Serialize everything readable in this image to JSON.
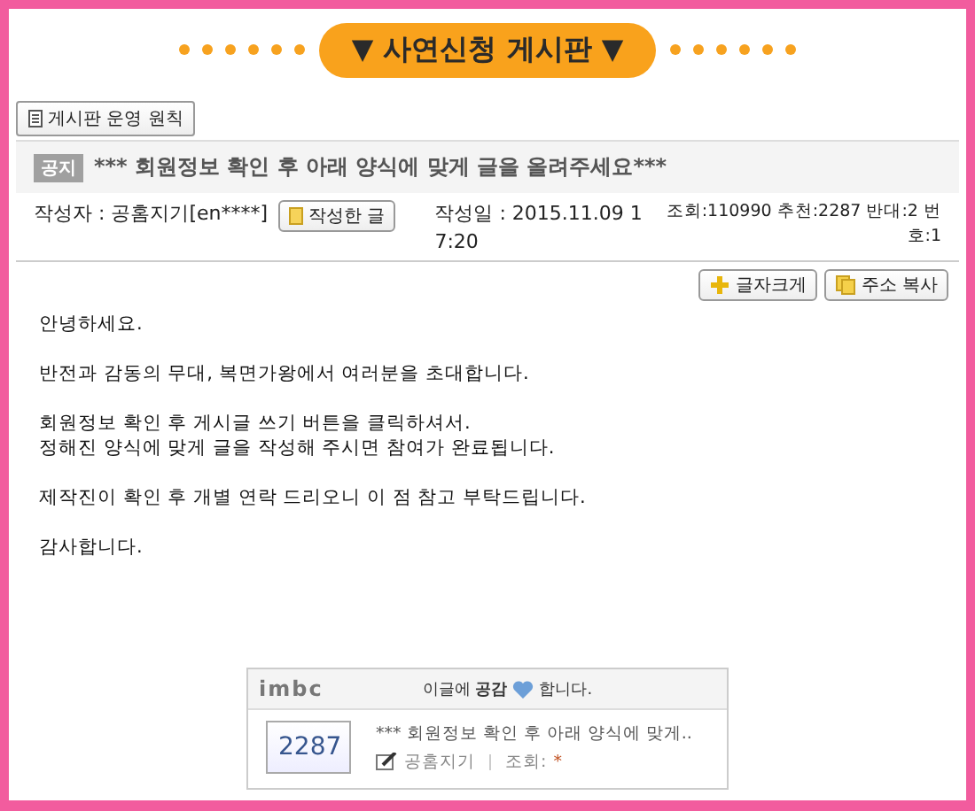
{
  "header": {
    "title": "▼ 사연신청 게시판 ▼"
  },
  "rules_button": "게시판 운영 원칙",
  "post": {
    "notice_badge": "공지",
    "title": "*** 회원정보 확인 후 아래 양식에 맞게 글을 올려주세요***",
    "author": "작성자 : 공홈지기[en****]",
    "author_posts_button": "작성한 글",
    "date": "작성일 : 2015.11.09 17:20",
    "stats": "조회:110990 추천:2287 반대:2 번호:1"
  },
  "tools": [
    "글자크게",
    "주소 복사"
  ],
  "body": [
    "안녕하세요.",
    "반전과 감동의 무대, 복면가왕에서 여러분을 초대합니다.",
    "회원정보 확인 후 게시글 쓰기 버튼을 클릭하셔서.\n정해진 양식에 맞게 글을 작성해 주시면  참여가 완료됩니다.",
    "제작진이 확인 후 개별 연락 드리오니 이 점 참고 부탁드립니다.",
    "감사합니다."
  ],
  "like_box": {
    "logo": "imbc",
    "prompt": "이글에 **공감**",
    "prompt_end": "합니다.",
    "count": "2287",
    "post_title": "*** 회원정보 확인 후 아래 양식에 맞게..",
    "author": "공홈지기",
    "views_label": "조회:",
    "views_value": "*"
  }
}
